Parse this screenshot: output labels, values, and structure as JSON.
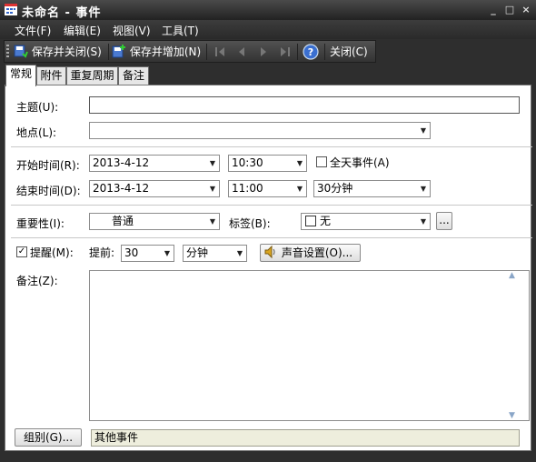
{
  "window": {
    "title": "未命名 - 事件",
    "minimize": "_",
    "maximize": "□",
    "close": "×"
  },
  "menu": [
    "文件(F)",
    "编辑(E)",
    "视图(V)",
    "工具(T)"
  ],
  "toolbar": {
    "save_close": "保存并关闭(S)",
    "save_new": "保存并增加(N)",
    "close": "关闭(C)",
    "help_glyph": "?"
  },
  "tabs": [
    "常规",
    "附件",
    "重复周期",
    "备注"
  ],
  "form": {
    "subject_label": "主题(U):",
    "subject_value": "",
    "location_label": "地点(L):",
    "location_value": "",
    "start_label": "开始时间(R):",
    "start_date": "2013-4-12",
    "start_time": "10:30",
    "allday_label": "全天事件(A)",
    "end_label": "结束时间(D):",
    "end_date": "2013-4-12",
    "end_time": "11:00",
    "duration": "30分钟",
    "importance_label": "重要性(I):",
    "importance_value": "普通",
    "tag_label": "标签(B):",
    "tag_value": "无",
    "tag_more": "...",
    "reminder_label": "提醒(M):",
    "reminder_checked": true,
    "before_label": "提前:",
    "reminder_amount": "30",
    "reminder_unit": "分钟",
    "sound_button": "声音设置(O)...",
    "notes_label": "备注(Z):",
    "notes_value": "",
    "group_button": "组别(G)...",
    "group_value": "其他事件"
  },
  "colors": {
    "titlebar": "#2a2a2a",
    "menubar": "#333333",
    "panel": "#ffffff",
    "group_field": "#eeeedd"
  }
}
